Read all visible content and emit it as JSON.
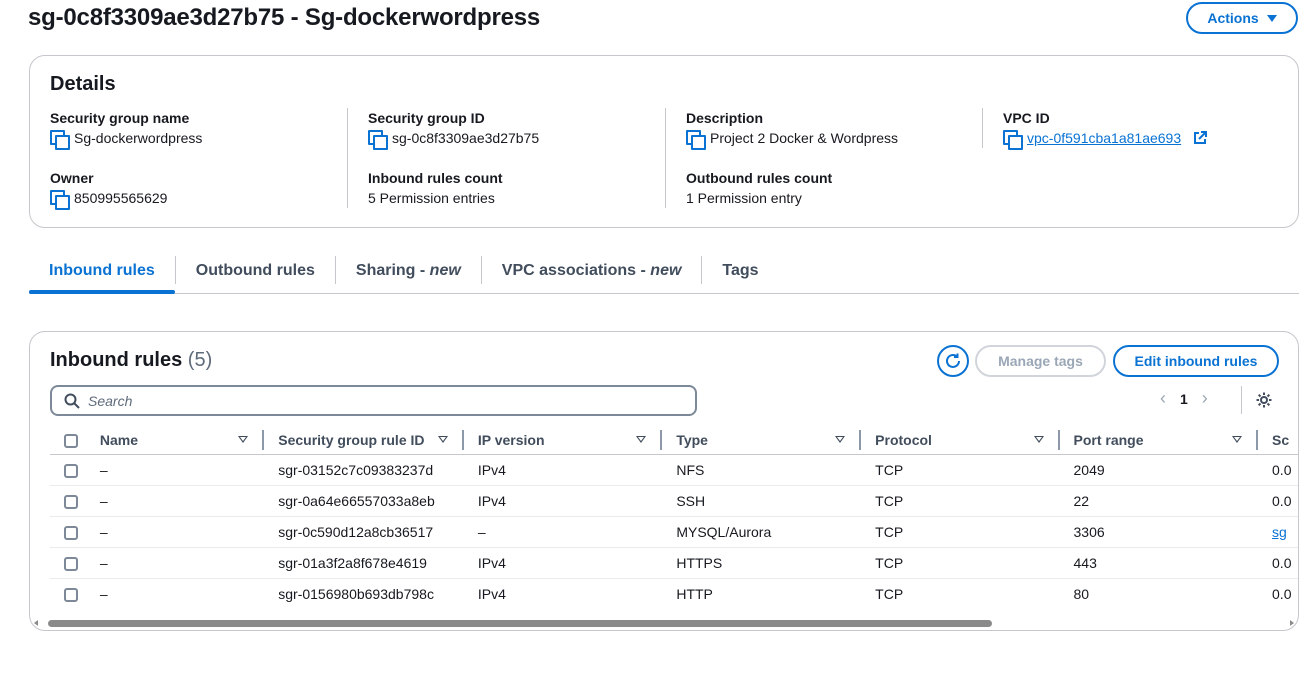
{
  "header": {
    "title": "sg-0c8f3309ae3d27b75 - Sg-dockerwordpress",
    "actions_label": "Actions"
  },
  "details": {
    "title": "Details",
    "security_group_name": {
      "label": "Security group name",
      "value": "Sg-dockerwordpress"
    },
    "security_group_id": {
      "label": "Security group ID",
      "value": "sg-0c8f3309ae3d27b75"
    },
    "description": {
      "label": "Description",
      "value": "Project 2 Docker & Wordpress"
    },
    "vpc_id": {
      "label": "VPC ID",
      "value": "vpc-0f591cba1a81ae693"
    },
    "owner": {
      "label": "Owner",
      "value": "850995565629"
    },
    "inbound_rules_count": {
      "label": "Inbound rules count",
      "value": "5 Permission entries"
    },
    "outbound_rules_count": {
      "label": "Outbound rules count",
      "value": "1 Permission entry"
    }
  },
  "tabs": [
    {
      "label": "Inbound rules",
      "suffix": "",
      "active": true
    },
    {
      "label": "Outbound rules",
      "suffix": "",
      "active": false
    },
    {
      "label": "Sharing - ",
      "suffix": "new",
      "active": false
    },
    {
      "label": "VPC associations - ",
      "suffix": "new",
      "active": false
    },
    {
      "label": "Tags",
      "suffix": "",
      "active": false
    }
  ],
  "inbound": {
    "title": "Inbound rules",
    "count": "(5)",
    "manage_tags_label": "Manage tags",
    "edit_label": "Edit inbound rules",
    "search_placeholder": "Search",
    "page": "1",
    "columns": [
      "Name",
      "Security group rule ID",
      "IP version",
      "Type",
      "Protocol",
      "Port range",
      "Sc"
    ],
    "rows": [
      {
        "name": "–",
        "rule_id": "sgr-03152c7c09383237d",
        "ip_version": "IPv4",
        "type": "NFS",
        "protocol": "TCP",
        "port_range": "2049",
        "source": "0.0"
      },
      {
        "name": "–",
        "rule_id": "sgr-0a64e66557033a8eb",
        "ip_version": "IPv4",
        "type": "SSH",
        "protocol": "TCP",
        "port_range": "22",
        "source": "0.0"
      },
      {
        "name": "–",
        "rule_id": "sgr-0c590d12a8cb36517",
        "ip_version": "–",
        "type": "MYSQL/Aurora",
        "protocol": "TCP",
        "port_range": "3306",
        "source": "sg"
      },
      {
        "name": "–",
        "rule_id": "sgr-01a3f2a8f678e4619",
        "ip_version": "IPv4",
        "type": "HTTPS",
        "protocol": "TCP",
        "port_range": "443",
        "source": "0.0"
      },
      {
        "name": "–",
        "rule_id": "sgr-0156980b693db798c",
        "ip_version": "IPv4",
        "type": "HTTP",
        "protocol": "TCP",
        "port_range": "80",
        "source": "0.0"
      }
    ]
  },
  "colors": {
    "accent": "#0972d3",
    "text": "#16191f",
    "border": "#c6c6cd",
    "disabled": "#9ba7b6"
  },
  "icons": [
    "copy-icon",
    "external-link-icon",
    "refresh-icon",
    "search-icon",
    "chevron-left-icon",
    "chevron-right-icon",
    "settings-gear-icon",
    "sort-caret-icon",
    "dropdown-caret-icon"
  ]
}
